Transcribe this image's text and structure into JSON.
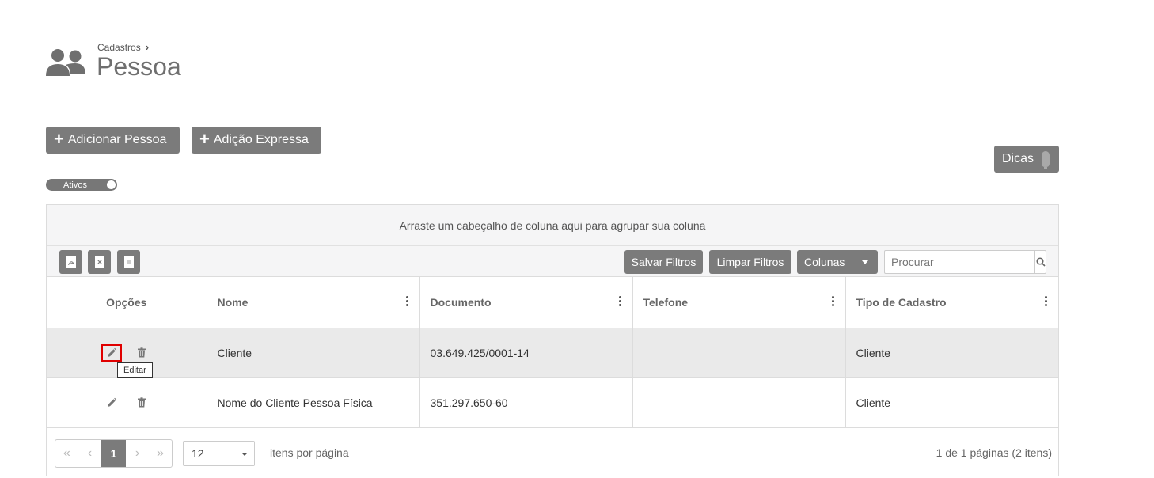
{
  "header": {
    "breadcrumb": "Cadastros",
    "breadcrumb_sep": "›",
    "title": "Pessoa",
    "icon": "users-icon"
  },
  "actions": {
    "add_label": "Adicionar Pessoa",
    "express_label": "Adição Expressa",
    "plus": "+",
    "dicas_label": "Dicas"
  },
  "filter_toggle": {
    "label": "Ativos",
    "on": true
  },
  "grid": {
    "group_hint": "Arraste um cabeçalho de coluna aqui para agrupar sua coluna",
    "exports": [
      "pdf-export-icon",
      "excel-export-icon",
      "csv-export-icon"
    ],
    "toolbar": {
      "save_filters": "Salvar Filtros",
      "clear_filters": "Limpar Filtros",
      "columns": "Colunas",
      "search_placeholder": "Procurar"
    },
    "columns": [
      "Opções",
      "Nome",
      "Documento",
      "Telefone",
      "Tipo de Cadastro"
    ],
    "rows": [
      {
        "nome": "Cliente",
        "documento": "03.649.425/0001-14",
        "telefone": "",
        "tipo": "Cliente"
      },
      {
        "nome": "Nome do Cliente Pessoa Física",
        "documento": "351.297.650-60",
        "telefone": "",
        "tipo": "Cliente"
      }
    ],
    "tooltip": "Editar"
  },
  "pager": {
    "first": "«",
    "prev": "‹",
    "current": "1",
    "next": "›",
    "last": "»",
    "page_size": "12",
    "per_page_label": "itens por página",
    "info": "1 de 1 páginas (2 itens)"
  },
  "colors": {
    "button_gray": "#7b7b7b",
    "highlight_red": "#e00000",
    "row_hover": "#eaeaea"
  }
}
